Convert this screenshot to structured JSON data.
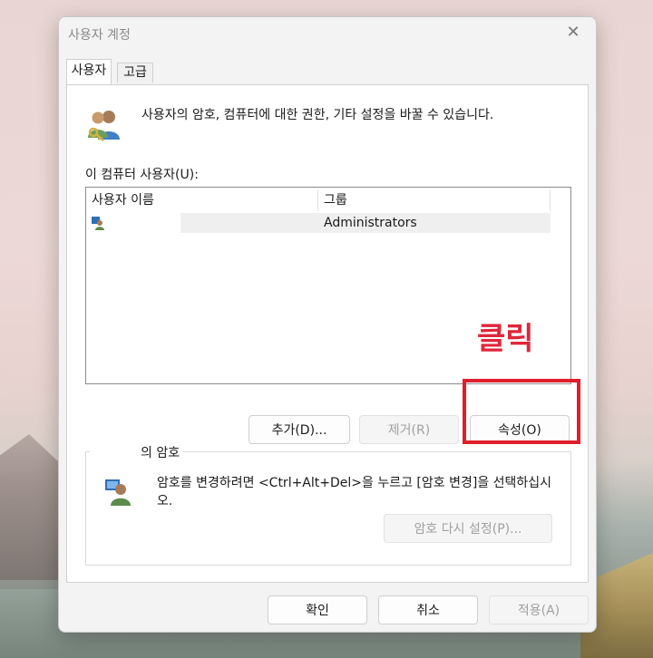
{
  "window": {
    "title": "사용자 계정"
  },
  "tabs": [
    {
      "label": "사용자"
    },
    {
      "label": "고급"
    }
  ],
  "description": "사용자의 암호, 컴퓨터에 대한 권한, 기타 설정을 바꿀 수 있습니다.",
  "user_list": {
    "label": "이 컴퓨터 사용자(U):",
    "columns": [
      "사용자 이름",
      "그룹"
    ],
    "rows": [
      {
        "name": "",
        "group": "Administrators"
      }
    ]
  },
  "list_buttons": {
    "add": "추가(D)...",
    "remove": "제거(R)",
    "properties": "속성(O)"
  },
  "password_group": {
    "title": "의 암호",
    "text": "암호를 변경하려면 <Ctrl+Alt+Del>을 누르고 [암호 변경]을 선택하십시오.",
    "reset_button": "암호 다시 설정(P)..."
  },
  "footer_buttons": {
    "ok": "확인",
    "cancel": "취소",
    "apply": "적용(A)"
  },
  "annotation": {
    "text": "클릭",
    "color": "#e0263a"
  },
  "icons": {
    "close": "close-icon",
    "users": "users-key-icon",
    "user_row": "user-icon",
    "password": "user-password-icon"
  }
}
